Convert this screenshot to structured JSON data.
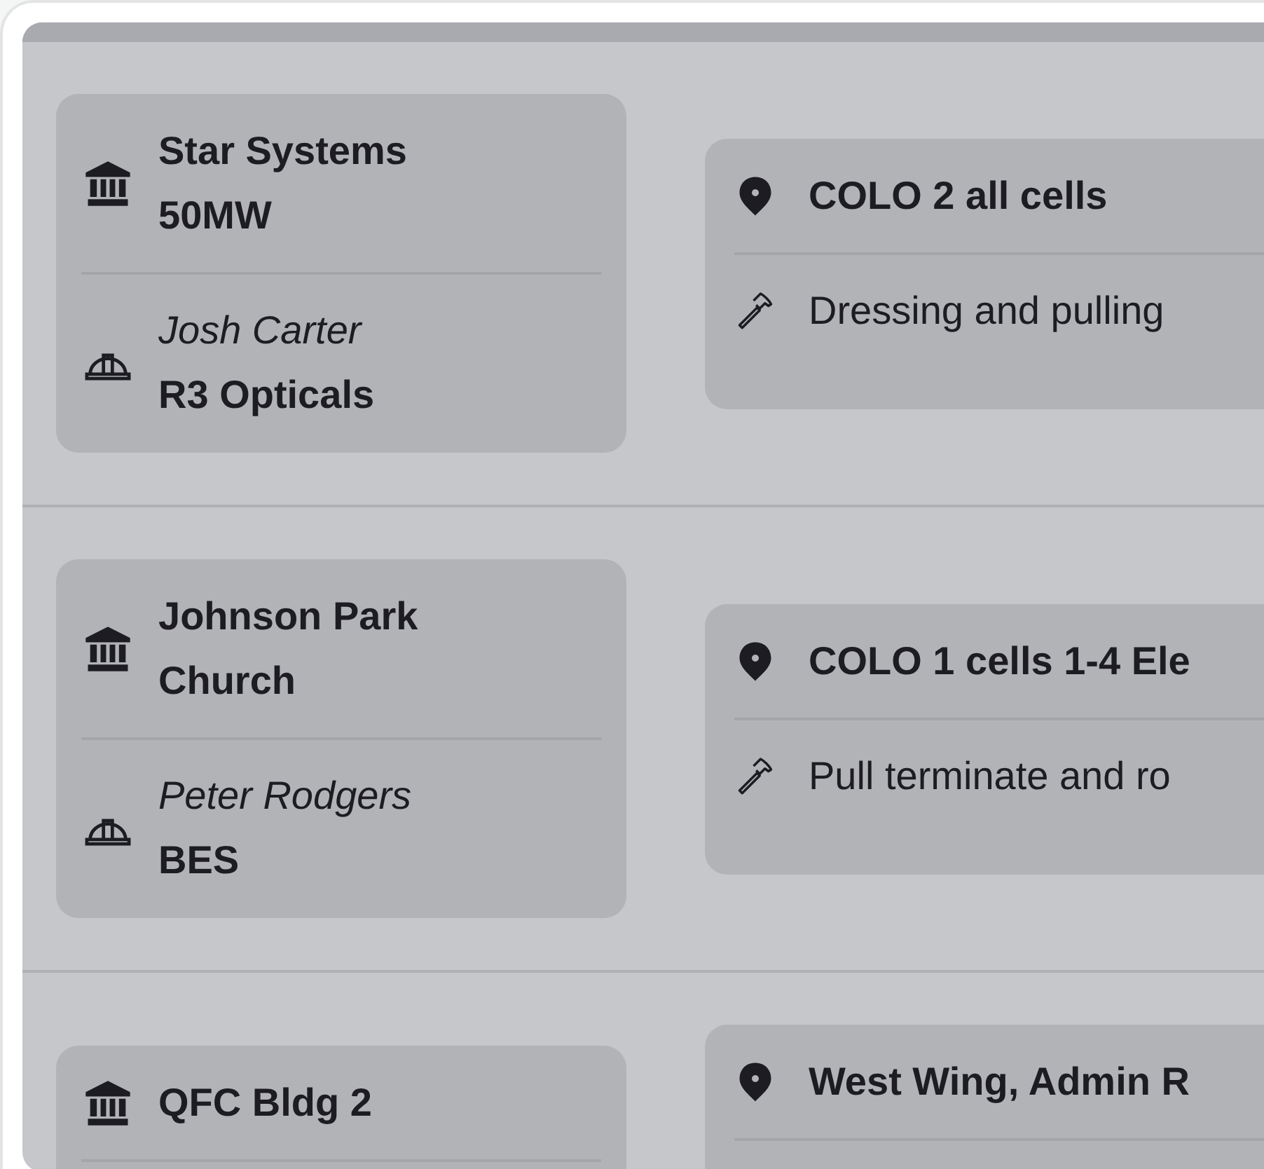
{
  "rows": [
    {
      "site": "Star Systems 50MW",
      "contact": "Josh Carter",
      "company": "R3 Opticals",
      "location": "COLO 2 all cells",
      "task": "Dressing and pulling"
    },
    {
      "site": "Johnson Park Church",
      "contact": "Peter Rodgers",
      "company": "BES",
      "location": "COLO 1 cells 1-4 Ele",
      "task": "Pull terminate and ro"
    },
    {
      "site": "QFC Bldg 2",
      "location": "West Wing, Admin R"
    }
  ]
}
